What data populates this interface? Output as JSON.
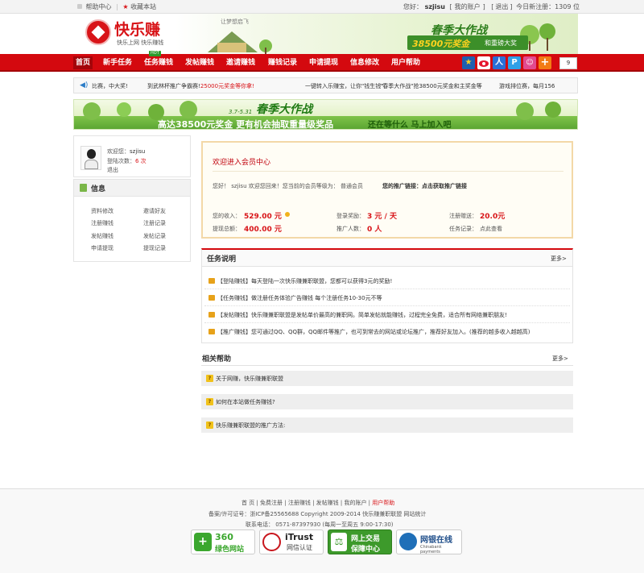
{
  "topbar": {
    "help": "帮助中心",
    "sep": "|",
    "fav": "收藏本站",
    "welcome_prefix": "您好：",
    "username": "szjisu",
    "my_account": "我的账户",
    "logout": "退出",
    "today_reg": "今日新注册：1309 位"
  },
  "header": {
    "logo_text": "快乐赚",
    "logo_sub": "快乐上网 快乐赚钱",
    "slogan": "让梦想启飞",
    "banner_title": "春季大作战",
    "banner_amount": "38500元奖金",
    "banner_more": "和重磅大奖"
  },
  "nav": {
    "items": [
      "首页",
      "新手任务",
      "任务赚钱",
      "发帖赚钱",
      "邀请赚钱",
      "赚钱记录",
      "申请提现",
      "信息修改",
      "用户帮助"
    ],
    "hot": "HOT",
    "share_count": "9"
  },
  "ticker": {
    "items": [
      {
        "text": "比赛，中大奖!"
      },
      {
        "text": "到武林杯推广争霸赛!",
        "highlight": "25000元奖金等你拿!"
      },
      {
        "text": "一键转入乐赚宝，让你\"钱生钱\""
      },
      {
        "text": "\"春季大作战\"抢38500元奖金和主奖金等"
      },
      {
        "text": "游戏排位赛，每月156"
      }
    ]
  },
  "banner": {
    "date": "3.7-5.31",
    "title": "春季大作战",
    "line1": "高达38500元奖金 更有机会抽取重量级奖品",
    "line2": "还在等什么 马上加入吧"
  },
  "sidebar": {
    "welcome_label": "欢迎您：",
    "welcome_user": "szjisu",
    "login_label": "登陆次数：",
    "login_count": "6 次",
    "logout": "退出",
    "info_title": "信息",
    "links": [
      "资料修改",
      "邀请好友",
      "注册赚钱",
      "注册记录",
      "发帖赚钱",
      "发帖记录",
      "申请提现",
      "提现记录"
    ]
  },
  "welcome": {
    "title": "欢迎进入会员中心",
    "intro": "您好！ szjisu 欢迎您回来！您当前的会员等级为：",
    "level": "普通会员",
    "promo": "您的推广链接：点击获取推广链接",
    "income_label": "您的收入：",
    "income": "529.00 元",
    "login_reward_label": "登录奖励：",
    "login_reward": "3 元 / 天",
    "reg_reward_label": "注册赠送：",
    "reg_reward": "20.0元",
    "withdraw_label": "提现总额：",
    "withdraw": "400.00 元",
    "promoters_label": "推广人数：",
    "promoters": "0 人",
    "task_rec_label": "任务记录：",
    "task_rec": "点此查看"
  },
  "tasks": {
    "title": "任务说明",
    "more": "更多>",
    "items": [
      "【登陆赚钱】每天登陆一次快乐赚兼职联盟，您都可以获得3元的奖励!",
      "【任务赚钱】做注册任务体验广告赚钱 每个注册任务10-30元不等",
      "【发帖赚钱】快乐赚兼职联盟是发帖单价最高的兼职网。简单发帖就能赚钱，过程完全免费，适合所有网络兼职朋友!",
      "【推广赚钱】您可通过QQ、QQ群，QQ邮件等推广，也可到常去的网站或论坛推广，推荐好友加入。(推荐的越多收入越越高)"
    ]
  },
  "help": {
    "title": "相关帮助",
    "more": "更多>",
    "items": [
      "关于网赚，快乐赚兼职联盟",
      "如何在本站做任务赚钱?",
      "快乐赚兼职联盟的推广方法:"
    ]
  },
  "footer": {
    "links": "首 页 | 免费注册 | 注册赚钱 | 发帖赚钱 | 我的账户 |",
    "links_active": "用户帮助",
    "icp": "备案/许可证号：浙ICP备25565688   Copyright 2009-2014 快乐赚兼职联盟  网站统计",
    "phone": "联系电话： 0571-87397930 (每周一至周五 9:00-17:30)",
    "badges": [
      {
        "big": "360",
        "small": "绿色网站"
      },
      {
        "big": "iTrust",
        "small": "网信认证"
      },
      {
        "big": "网上交易",
        "small": "保障中心"
      },
      {
        "big": "网银在线",
        "small": "Chinabank payments"
      }
    ]
  },
  "colors": {
    "brand_red": "#d4090f",
    "accent_green": "#2b7d1a"
  }
}
